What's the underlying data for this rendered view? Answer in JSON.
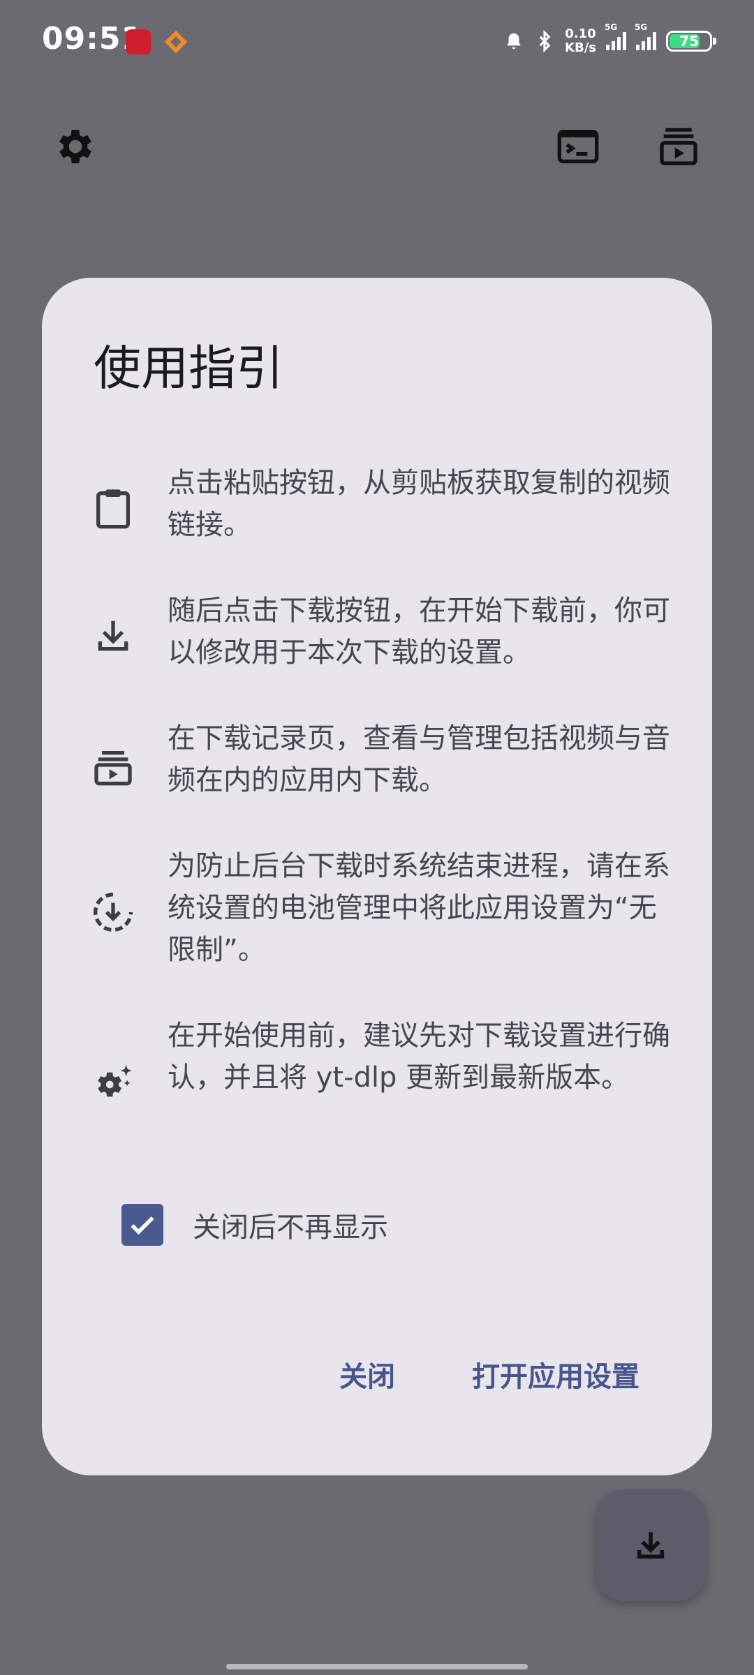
{
  "status_bar": {
    "time": "09:51",
    "net_speed_value": "0.10",
    "net_speed_unit": "KB/s",
    "network_1": "5G",
    "network_2": "5G",
    "battery_level": "75"
  },
  "top_bar": {
    "icons": [
      "settings-icon",
      "terminal-icon",
      "download-queue-icon"
    ]
  },
  "dialog": {
    "title": "使用指引",
    "items": [
      {
        "icon": "clipboard-icon",
        "text": "点击粘贴按钮，从剪贴板获取复制的视频链接。"
      },
      {
        "icon": "download-icon",
        "text": "随后点击下载按钮，在开始下载前，你可以修改用于本次下载的设置。"
      },
      {
        "icon": "download-queue-icon",
        "text": "在下载记录页，查看与管理包括视频与音频在内的应用内下载。"
      },
      {
        "icon": "download-circle-icon",
        "text": "为防止后台下载时系统结束进程，请在系统设置的电池管理中将此应用设置为“无限制”。"
      },
      {
        "icon": "settings-sparkle-icon",
        "text": "在开始使用前，建议先对下载设置进行确认，并且将 yt-dlp 更新到最新版本。"
      }
    ],
    "checkbox_label": "关闭后不再显示",
    "checkbox_checked": true,
    "close_button": "关闭",
    "open_settings_button": "打开应用设置"
  },
  "fab": {
    "icon": "download-icon"
  },
  "colors": {
    "scrim": "#6a6a70",
    "dialog_bg": "#e8e6ec",
    "primary": "#46558c",
    "checkbox": "#4a5a8e",
    "battery": "#3ddc84"
  }
}
